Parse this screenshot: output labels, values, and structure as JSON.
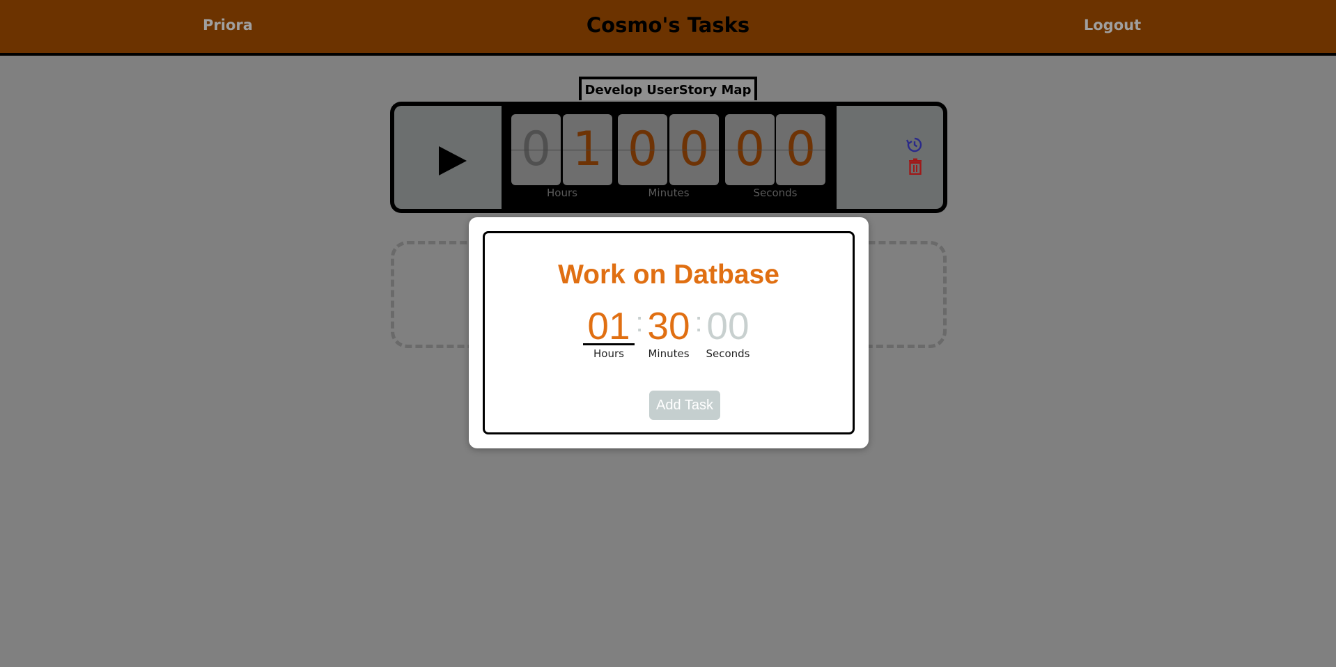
{
  "header": {
    "brand": "Priora",
    "title": "Cosmo's Tasks",
    "logout": "Logout"
  },
  "timer": {
    "task_name": "Develop UserStory Map",
    "digits": [
      "0",
      "1",
      "0",
      "0",
      "0",
      "0"
    ],
    "labels": {
      "hours": "Hours",
      "minutes": "Minutes",
      "seconds": "Seconds"
    },
    "icons": {
      "play": "play-icon",
      "reset": "history-icon",
      "delete": "trash-icon"
    }
  },
  "modal": {
    "title": "Work on Datbase",
    "hours": "01",
    "minutes": "30",
    "seconds": "00",
    "separator": ":",
    "labels": {
      "hours": "Hours",
      "minutes": "Minutes",
      "seconds": "Seconds"
    },
    "add_button": "Add Task"
  },
  "colors": {
    "header_bg": "#6c3300",
    "accent": "#e06f12",
    "overlay": "#808080",
    "disabled_button": "#c5cfcf",
    "reset_icon": "#2a2a8a",
    "delete_icon": "#a01818"
  }
}
